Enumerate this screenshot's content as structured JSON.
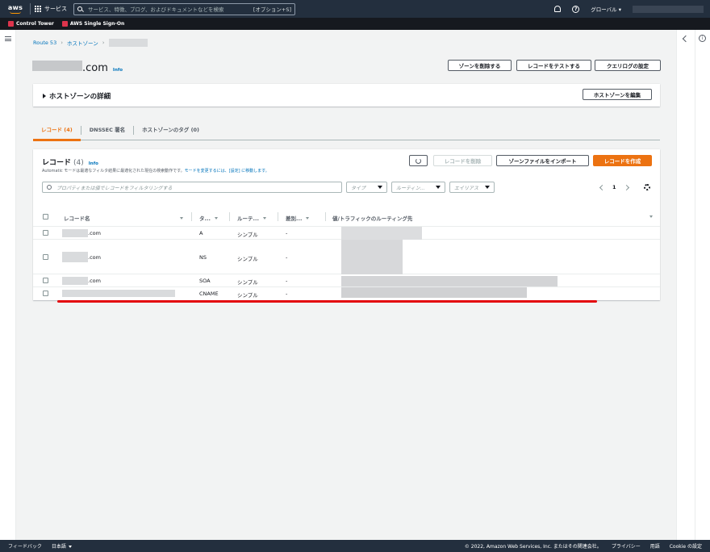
{
  "topnav": {
    "logo": "aws",
    "services_label": "サービス",
    "search_placeholder": "サービス、特徴、ブログ、およびドキュメントなどを検索",
    "search_shortcut": "[オプション+S]",
    "region_label": "グローバル"
  },
  "favorites": [
    {
      "label": "Control Tower"
    },
    {
      "label": "AWS Single Sign-On"
    }
  ],
  "breadcrumb": {
    "route53": "Route 53",
    "hosted_zones": "ホストゾーン"
  },
  "page": {
    "title_suffix": ".com",
    "info": "Info",
    "delete_zone": "ゾーンを削除する",
    "test_record": "レコードをテストする",
    "query_logging": "クエリログの設定"
  },
  "details": {
    "title": "ホストゾーンの詳細",
    "edit_button": "ホストゾーンを編集"
  },
  "tabs": [
    {
      "label": "レコード (4)"
    },
    {
      "label": "DNSSEC 署名"
    },
    {
      "label": "ホストゾーンのタグ (0)"
    }
  ],
  "records": {
    "title": "レコード",
    "count": "(4)",
    "info": "Info",
    "desc_text": "Automatic モードは最適なフィルタ結果に最適化された現在の検索動作です。",
    "desc_link": "モードを変更するには、[設定] に移動します。",
    "delete_button": "レコードを削除",
    "import_button": "ゾーンファイルをインポート",
    "create_button": "レコードを作成",
    "filter_placeholder": "プロパティまたは値でレコードをフィルタリングする",
    "filter_type": "タイプ",
    "filter_routing": "ルーティン...",
    "filter_alias": "エイリアス",
    "page_number": "1"
  },
  "table": {
    "headers": {
      "name": "レコード名",
      "type": "タ...",
      "routing": "ルーテ...",
      "diff": "差別...",
      "value": "値/トラフィックのルーティング先"
    },
    "rows": [
      {
        "name": ".com",
        "type": "A",
        "routing": "シンプル",
        "diff": "-"
      },
      {
        "name": ".com",
        "type": "NS",
        "routing": "シンプル",
        "diff": "-"
      },
      {
        "name": ".com",
        "type": "SOA",
        "routing": "シンプル",
        "diff": "-"
      },
      {
        "name": "",
        "type": "CNAME",
        "routing": "シンプル",
        "diff": "-"
      }
    ]
  },
  "footer": {
    "feedback": "フィードバック",
    "language": "日本語",
    "copyright": "© 2022, Amazon Web Services, Inc. またはその関連会社。",
    "privacy": "プライバシー",
    "terms": "用語",
    "cookie": "Cookie の設定"
  },
  "colors": {
    "nav_bg": "#232f3e",
    "accent": "#ec7211",
    "link": "#0073bb",
    "annotation_red": "#e3050b"
  }
}
